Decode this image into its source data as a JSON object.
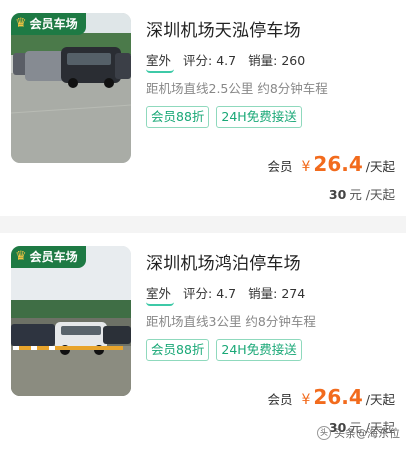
{
  "listings": [
    {
      "badge": "会员车场",
      "title": "深圳机场天泓停车场",
      "type": "室外",
      "rating_label": "评分:",
      "rating": "4.7",
      "sales_label": "销量:",
      "sales": "260",
      "distance": "距机场直线2.5公里 约8分钟车程",
      "tags": [
        "会员88折",
        "24H免费接送"
      ],
      "member_label": "会员",
      "currency": "¥",
      "member_price": "26.4",
      "price_unit": "/天起",
      "orig_price": "30",
      "orig_unit": "元 /天起"
    },
    {
      "badge": "会员车场",
      "title": "深圳机场鸿泊停车场",
      "type": "室外",
      "rating_label": "评分:",
      "rating": "4.7",
      "sales_label": "销量:",
      "sales": "274",
      "distance": "距机场直线3公里 约8分钟车程",
      "tags": [
        "会员88折",
        "24H免费接送"
      ],
      "member_label": "会员",
      "currency": "¥",
      "member_price": "26.4",
      "price_unit": "/天起",
      "orig_price": "30",
      "orig_unit": "元 /天起"
    }
  ],
  "watermark": "头条@海东位",
  "icons": {
    "badge_icon": "crown-icon"
  },
  "colors": {
    "accent": "#f26b1d",
    "tag": "#1aa877",
    "badge": "#1e7a44"
  }
}
